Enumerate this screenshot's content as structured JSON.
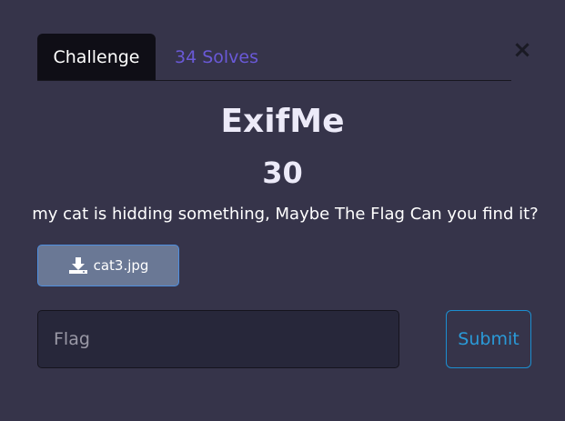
{
  "modal": {
    "close_glyph": "×",
    "tabs": [
      {
        "label": "Challenge",
        "active": true
      },
      {
        "label": "34 Solves",
        "active": false
      }
    ],
    "challenge": {
      "name": "ExifMe",
      "points": "30",
      "description": "my cat is hidding something, Maybe The Flag Can you find it?",
      "file": {
        "label": "cat3.jpg",
        "icon": "download-icon"
      }
    },
    "flag_input": {
      "value": "",
      "placeholder": "Flag"
    },
    "submit_label": "Submit"
  },
  "colors": {
    "background": "#36344a",
    "active_tab": "#0f0e16",
    "inactive_tab_text": "#6a59d8",
    "file_button": "#6a7895",
    "submit_border": "#1c8ed0"
  }
}
